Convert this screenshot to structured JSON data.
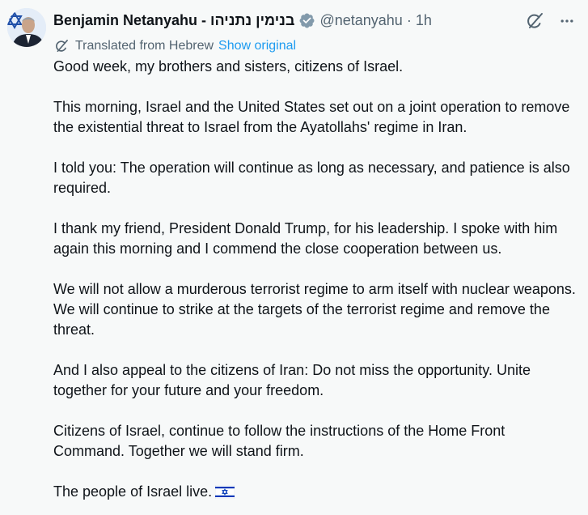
{
  "author": {
    "display_name": "Benjamin Netanyahu - בנימין נתניהו",
    "handle": "@netanyahu",
    "separator": "·",
    "time": "1h",
    "verified_icon": "verified-badge-icon"
  },
  "translation": {
    "label": "Translated from Hebrew",
    "show_original": "Show original"
  },
  "tweet": {
    "paragraphs": [
      "Good week, my brothers and sisters, citizens of Israel.",
      "This morning, Israel and the United States set out on a joint operation to remove the existential threat to Israel from the Ayatollahs' regime in Iran.",
      "I told you: The operation will continue as long as necessary, and patience is also required.",
      "I thank my friend, President Donald Trump, for his leadership. I spoke with him again this morning and I commend the close cooperation between us.",
      "We will not allow a murderous terrorist regime to arm itself with nuclear weapons. We will continue to strike at the targets of the terrorist regime and remove the threat.",
      "And I also appeal to the citizens of Iran: Do not miss the opportunity. Unite together for your future and your freedom.",
      "Citizens of Israel, continue to follow the instructions of the Home Front Command. Together we will stand firm.",
      "The people of Israel live."
    ],
    "closing_emoji": "israel-flag-icon"
  },
  "colors": {
    "text": "#0f1419",
    "secondary": "#536471",
    "link": "#1d9bf0",
    "verified": "#829aab",
    "background": "#f7f9f9"
  }
}
